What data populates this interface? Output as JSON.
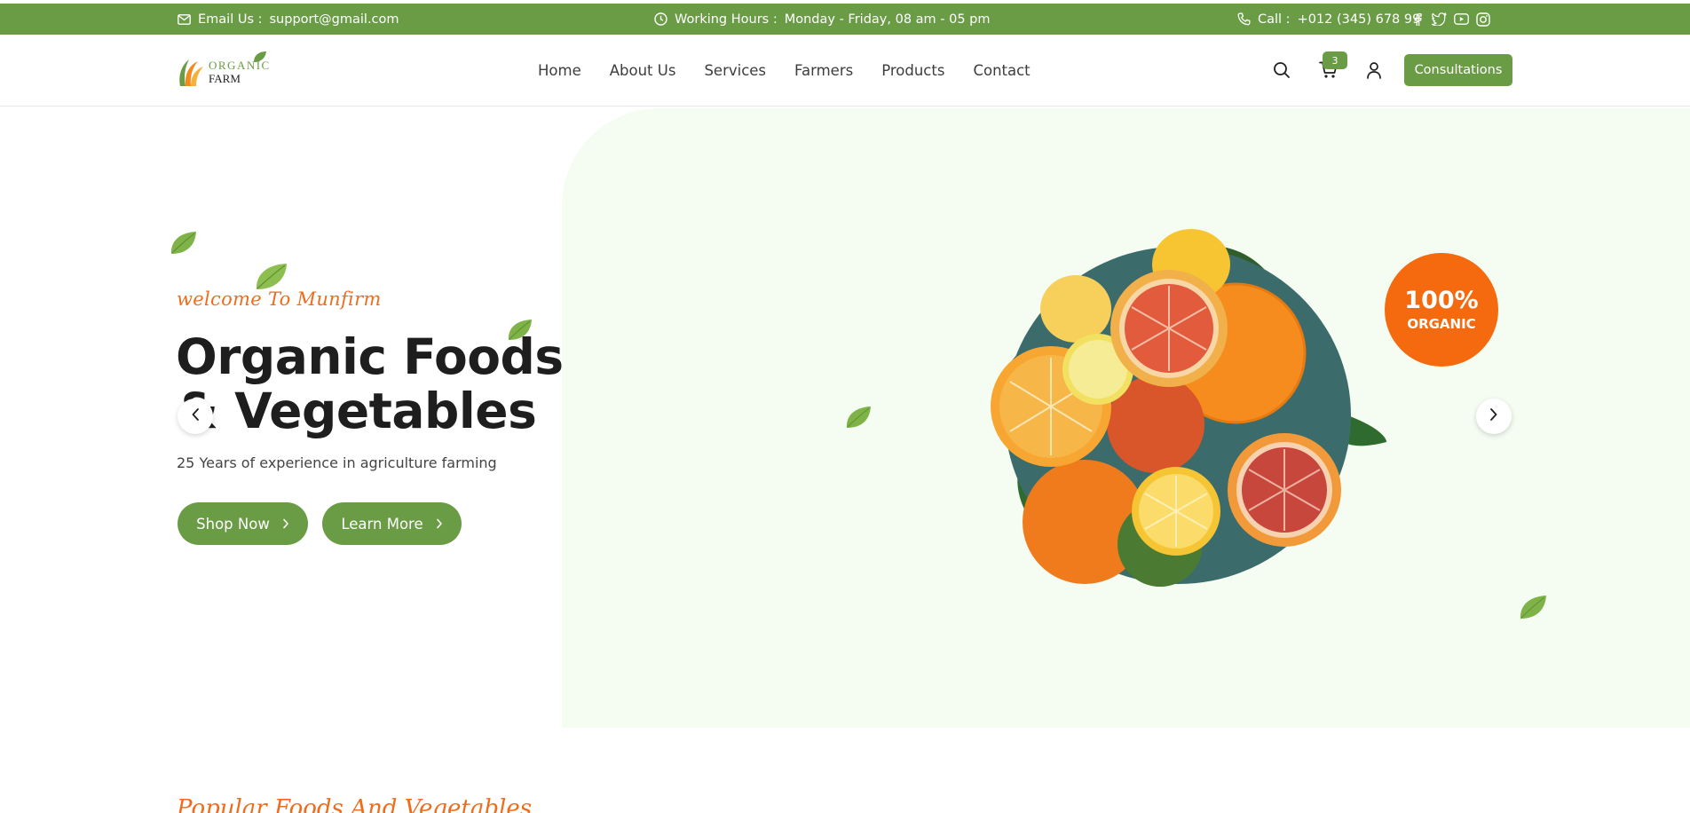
{
  "topbar": {
    "email_label": "Email Us :",
    "email_value": "support@gmail.com",
    "hours_label": "Working Hours :",
    "hours_value": "Monday - Friday, 08 am - 05 pm",
    "call_label": "Call :",
    "call_value": "+012 (345) 678 99",
    "social_icons": [
      "facebook-icon",
      "twitter-icon",
      "youtube-icon",
      "instagram-icon"
    ]
  },
  "logo": {
    "word1": "ORGANIC",
    "word2": "FARM"
  },
  "nav": {
    "items": [
      {
        "label": "Home"
      },
      {
        "label": "About Us"
      },
      {
        "label": "Services"
      },
      {
        "label": "Farmers"
      },
      {
        "label": "Products"
      },
      {
        "label": "Contact"
      }
    ]
  },
  "header": {
    "cart_count": "3",
    "cta_label": "Consultations",
    "icons": [
      "search-icon",
      "cart-icon",
      "user-icon"
    ]
  },
  "hero": {
    "welcome": "welcome To Munfirm",
    "title_line1": "Organic Foods",
    "title_line2": "& Vegetables",
    "subtitle": "25 Years of experience in agriculture farming",
    "shop_label": "Shop Now",
    "learn_label": "Learn More",
    "badge_big": "100%",
    "badge_small": "ORGANIC"
  },
  "next_section": {
    "heading": "Popular Foods And Vegetables"
  },
  "colors": {
    "brand_green": "#6a9c46",
    "accent_orange": "#f56a0e",
    "hero_bg": "#f5fcf2"
  }
}
